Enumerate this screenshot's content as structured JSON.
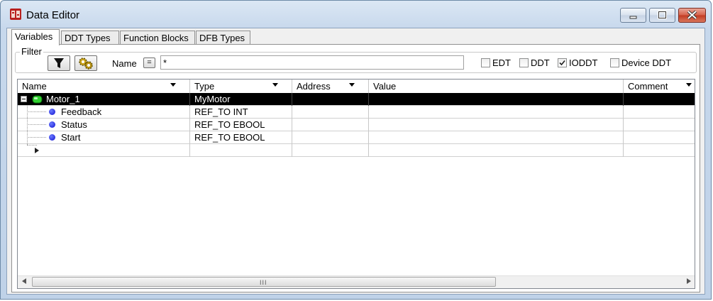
{
  "window": {
    "title": "Data Editor",
    "icon": "unity-app-icon"
  },
  "title_controls": {
    "minimize_icon": "minimize-icon",
    "maximize_icon": "maximize-icon",
    "close_icon": "close-icon"
  },
  "tabs": [
    {
      "label": "Variables",
      "active": true
    },
    {
      "label": "DDT Types",
      "active": false
    },
    {
      "label": "Function Blocks",
      "active": false
    },
    {
      "label": "DFB Types",
      "active": false
    }
  ],
  "filter": {
    "group_label": "Filter",
    "name_label": "Name",
    "equals_label": "=",
    "name_value": "*",
    "options": [
      {
        "label": "EDT",
        "checked": false
      },
      {
        "label": "DDT",
        "checked": false
      },
      {
        "label": "IODDT",
        "checked": true
      },
      {
        "label": "Device DDT",
        "checked": false
      }
    ]
  },
  "grid": {
    "columns": [
      "Name",
      "Type",
      "Address",
      "Value",
      "Comment"
    ],
    "rows": [
      {
        "name": "Motor_1",
        "type": "MyMotor",
        "address": "",
        "value": "",
        "comment": "",
        "level": 0,
        "expanded": true,
        "selected": true
      },
      {
        "name": "Feedback",
        "type": "REF_TO INT",
        "address": "",
        "value": "",
        "comment": "",
        "level": 1,
        "selected": false
      },
      {
        "name": "Status",
        "type": "REF_TO EBOOL",
        "address": "",
        "value": "",
        "comment": "",
        "level": 1,
        "selected": false
      },
      {
        "name": "Start",
        "type": "REF_TO EBOOL",
        "address": "",
        "value": "",
        "comment": "",
        "level": 1,
        "selected": false
      }
    ],
    "scroll_grip": "III"
  }
}
